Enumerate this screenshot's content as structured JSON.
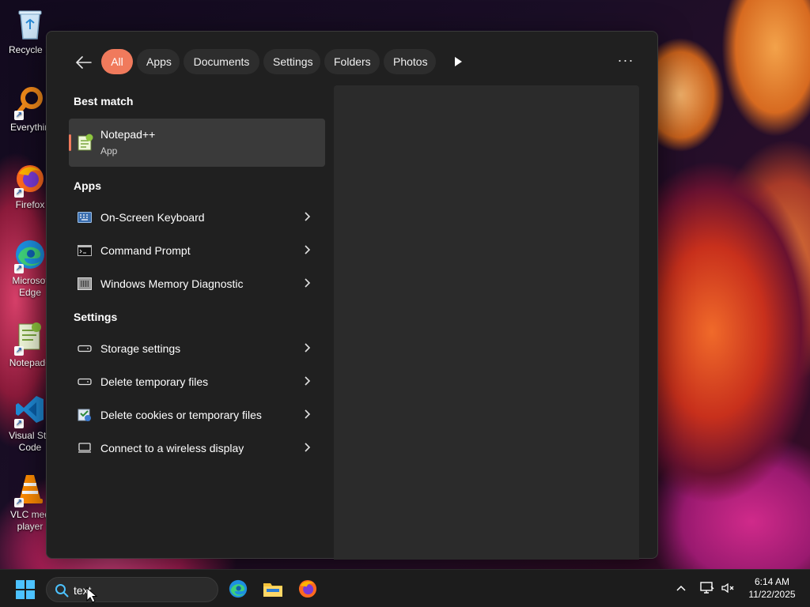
{
  "desktop": {
    "icons": [
      {
        "label": "Recycle B",
        "icon": "recycle-bin-icon"
      },
      {
        "label": "Everythin",
        "icon": "everything-search-icon"
      },
      {
        "label": "Firefox",
        "icon": "firefox-icon"
      },
      {
        "label": "Microsof\nEdge",
        "icon": "edge-icon"
      },
      {
        "label": "Notepad+",
        "icon": "notepadpp-icon"
      },
      {
        "label": "Visual Stu\nCode",
        "icon": "vscode-icon"
      },
      {
        "label": "VLC med\nplayer",
        "icon": "vlc-icon"
      }
    ]
  },
  "search_panel": {
    "filters": [
      "All",
      "Apps",
      "Documents",
      "Settings",
      "Folders",
      "Photos"
    ],
    "active_filter": "All",
    "more_label": "···",
    "best_match": {
      "heading": "Best match",
      "name": "Notepad++",
      "kind": "App"
    },
    "apps": {
      "heading": "Apps",
      "items": [
        {
          "label": "On-Screen Keyboard",
          "icon": "keyboard-icon"
        },
        {
          "label": "Command Prompt",
          "icon": "terminal-icon"
        },
        {
          "label": "Windows Memory Diagnostic",
          "icon": "memory-diagnostic-icon"
        }
      ]
    },
    "settings": {
      "heading": "Settings",
      "items": [
        {
          "label": "Storage settings",
          "icon": "storage-icon"
        },
        {
          "label": "Delete temporary files",
          "icon": "storage-icon"
        },
        {
          "label": "Delete cookies or temporary files",
          "icon": "internet-options-icon"
        },
        {
          "label": "Connect to a wireless display",
          "icon": "display-icon"
        }
      ]
    }
  },
  "taskbar": {
    "search_value": "text",
    "apps": [
      "edge-icon",
      "file-explorer-icon",
      "firefox-icon"
    ],
    "time": "6:14 AM",
    "date": "11/22/2025"
  },
  "colors": {
    "accent": "#f07a5c",
    "panel_bg": "#202020",
    "preview_bg": "#2b2b2b",
    "selected_row": "#3a3a3a"
  }
}
